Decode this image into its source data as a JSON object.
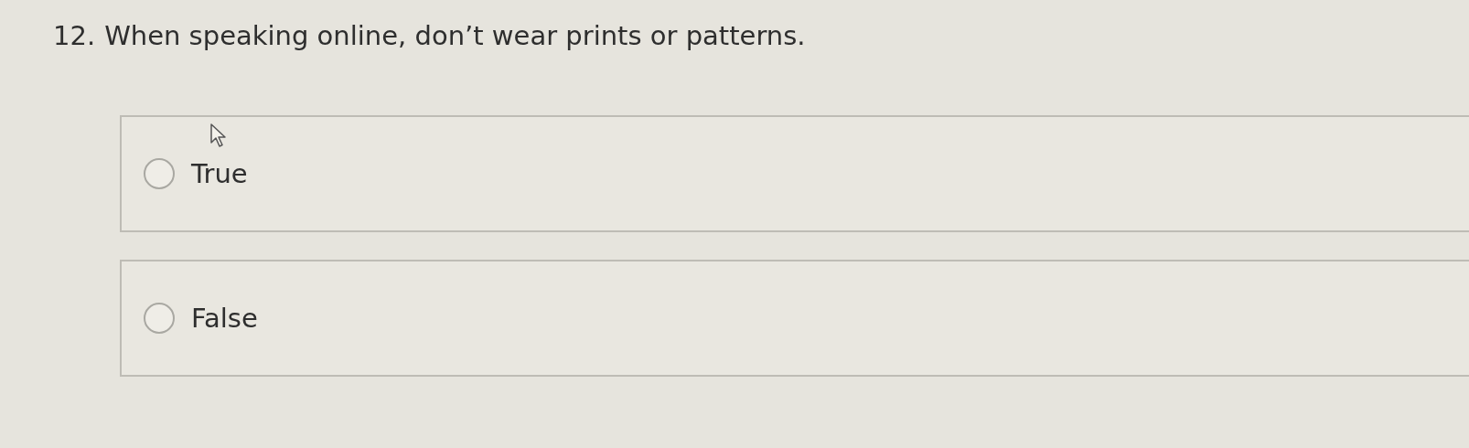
{
  "question": {
    "number": "12.",
    "text": "When speaking online, don’t wear prints or patterns."
  },
  "options": [
    {
      "label": "True",
      "selected": false
    },
    {
      "label": "False",
      "selected": false
    }
  ]
}
